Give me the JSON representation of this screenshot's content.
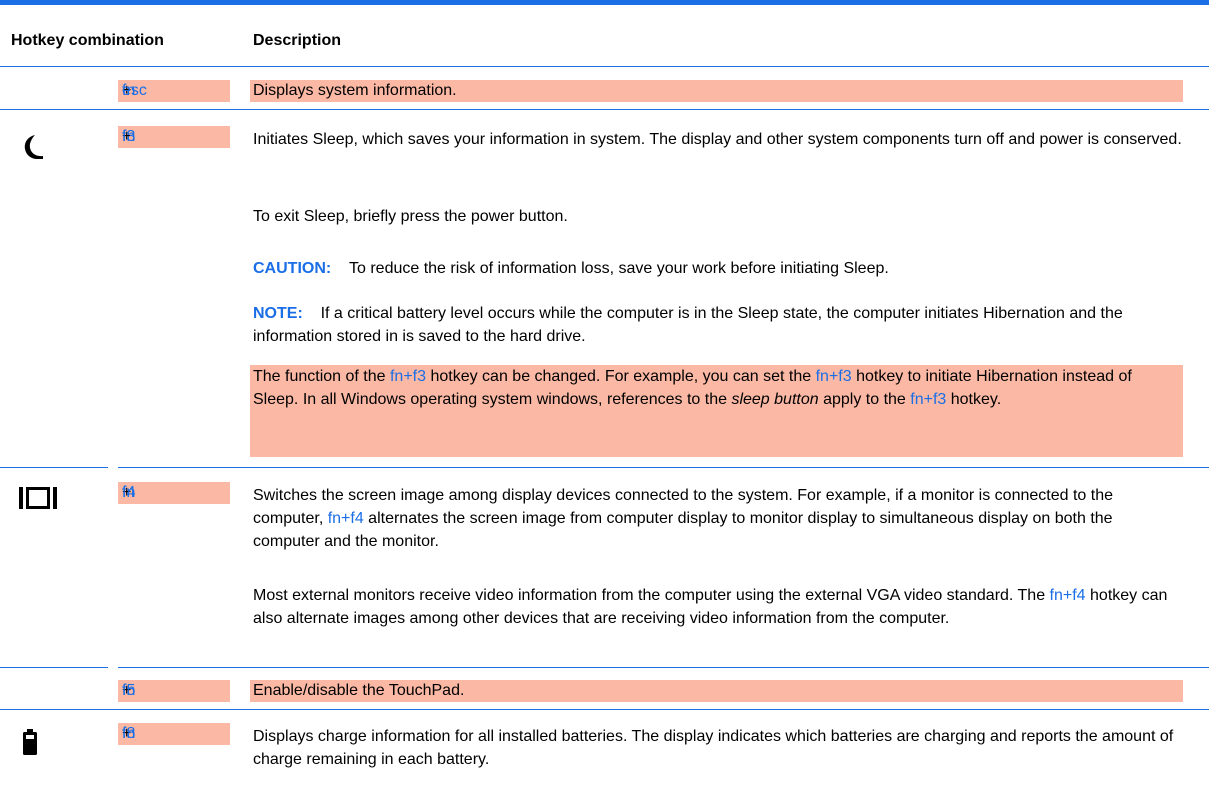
{
  "header": {
    "col1": "Hotkey combination",
    "col2": "Description"
  },
  "rows": [
    {
      "icon": "none",
      "key": {
        "fn": "fn",
        "plus": "+",
        "k": "esc"
      },
      "desc": "Displays system information."
    },
    {
      "icon": "moon-icon",
      "key": {
        "fn": "fn",
        "plus": "+",
        "k": "f3"
      },
      "p1": "Initiates Sleep, which saves your information in system. The display and other system components turn off and power is conserved.",
      "p2": "To exit Sleep, briefly press the power button.",
      "caution_label": "CAUTION:",
      "caution_text": "To reduce the risk of information loss, save your work before initiating Sleep.",
      "note_label": "NOTE:",
      "note_text": "If a critical battery level occurs while the computer is in the Sleep state, the computer initiates Hibernation and the information stored in is saved to the hard drive.",
      "fn_p": {
        "t1": "The function of the ",
        "k1": "fn+f3",
        "t2": " hotkey can be changed. For example, you can set the ",
        "k2": "fn+f3",
        "t3": " hotkey to initiate Hibernation instead of Sleep. In all Windows operating system windows, references to the ",
        "em": "sleep button",
        "t4": " apply to the ",
        "k3": "fn+f3",
        "t5": " hotkey."
      }
    },
    {
      "icon": "display-switch-icon",
      "key": {
        "fn": "fn",
        "plus": "+",
        "k": "f4"
      },
      "p1": {
        "t1": "Switches the screen image among display devices connected to the system. For example, if a monitor is connected to the computer, ",
        "k1": "fn+f4",
        "t2": " alternates the screen image from computer display to monitor display to simultaneous display on both the computer and the monitor."
      },
      "p2": {
        "t1": "Most external monitors receive video information from the computer using the external VGA video standard. The ",
        "k1": "fn+f4",
        "t2": " hotkey can also alternate images among other devices that are receiving video information from the computer."
      }
    },
    {
      "icon": "none",
      "key": {
        "fn": "fn",
        "plus": "+",
        "k": "f5"
      },
      "desc": "Enable/disable the TouchPad."
    },
    {
      "icon": "battery-icon",
      "key": {
        "fn": "fn",
        "plus": "+",
        "k": "f8"
      },
      "desc": "Displays charge information for all installed batteries. The display indicates which batteries are charging and reports the amount of charge remaining in each battery."
    }
  ]
}
